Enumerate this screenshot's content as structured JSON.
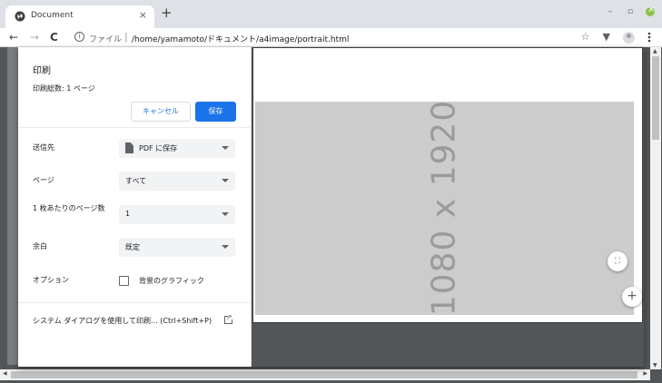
{
  "tab": {
    "title": "Document",
    "close": "×",
    "new_tab": "+"
  },
  "window": {
    "minimize": "–",
    "maximize": "▫"
  },
  "toolbar": {
    "back": "←",
    "forward": "→",
    "reload": "C",
    "info": "i",
    "scheme": "ファイル",
    "separator": "|",
    "url": "/home/yamamoto/ドキュメント/a4image/portrait.html",
    "star": "☆",
    "extension": "▼"
  },
  "print": {
    "title": "印刷",
    "total_pages": "印刷総数: 1 ページ",
    "cancel": "キャンセル",
    "save": "保存",
    "destination": {
      "label": "送信先",
      "value": "PDF に保存",
      "icon": "document-icon"
    },
    "pages": {
      "label": "ページ",
      "value": "すべて"
    },
    "pages_per_sheet": {
      "label": "1 枚あたりのページ数",
      "value": "1"
    },
    "margins": {
      "label": "余白",
      "value": "既定"
    },
    "options": {
      "label": "オプション",
      "checkbox_label": "背景のグラフィック",
      "checked": false
    },
    "system_dialog": "システム ダイアログを使用して印刷... (Ctrl+Shift+P)"
  },
  "preview": {
    "image_text": "1080 x 1920",
    "fit_icon": "⛶",
    "zoom_in": "+"
  },
  "colors": {
    "accent": "#1a73e8",
    "preview_bg": "#525659",
    "image_bg": "#cccccc"
  }
}
